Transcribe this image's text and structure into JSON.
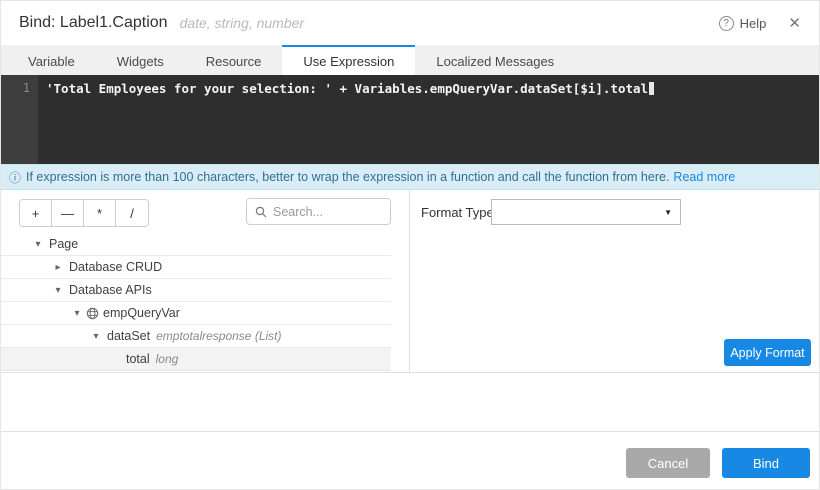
{
  "header": {
    "title": "Bind: Label1.Caption",
    "subtitle": "date, string, number",
    "help_icon": "?",
    "help_label": "Help",
    "close_icon": "✕"
  },
  "tabs": [
    {
      "label": "Variable",
      "active": false
    },
    {
      "label": "Widgets",
      "active": false
    },
    {
      "label": "Resource",
      "active": false
    },
    {
      "label": "Use Expression",
      "active": true
    },
    {
      "label": "Localized Messages",
      "active": false
    }
  ],
  "editor": {
    "line_number": "1",
    "code": "'Total Employees for your selection: ' + Variables.empQueryVar.dataSet[$i].total"
  },
  "info_bar": {
    "icon": "ⓘ",
    "text": "If expression is more than 100 characters, better to wrap the expression in a function and call the function from here.",
    "link": "Read more"
  },
  "toolbar": {
    "operators": [
      "+",
      "—",
      "*",
      "/"
    ],
    "search_placeholder": "Search..."
  },
  "tree": {
    "items": [
      {
        "label": "Page",
        "arrow": "▾",
        "state": "expanded",
        "level": 1
      },
      {
        "label": "Database CRUD",
        "arrow": "▸",
        "state": "collapsed",
        "level": 2
      },
      {
        "label": "Database APIs",
        "arrow": "▾",
        "state": "expanded",
        "level": 2
      },
      {
        "label": "empQueryVar",
        "arrow": "▾",
        "state": "expanded",
        "level": 3,
        "icon": "service-variable-globe"
      },
      {
        "label": "dataSet",
        "meta": "emptotalresponse (List)",
        "arrow": "▾",
        "state": "expanded",
        "level": 4
      },
      {
        "label": "total",
        "meta": "long",
        "state": "leaf",
        "level": 5,
        "selected": true
      }
    ]
  },
  "format_panel": {
    "label": "Format Type",
    "selected_value": "",
    "caret_icon": "▼",
    "apply_button": "Apply Format"
  },
  "footer": {
    "cancel": "Cancel",
    "bind": "Bind"
  },
  "colors": {
    "accent_blue": "#1788e3",
    "info_bg": "#d9edf7",
    "info_text": "#31708f",
    "editor_bg": "#2e2e2e",
    "gutter_bg": "#3d3d3d",
    "cancel_gray": "#a9a9a9",
    "selected_row_bg": "#f3f3f3",
    "tabbar_bg": "#f0f0f0"
  }
}
